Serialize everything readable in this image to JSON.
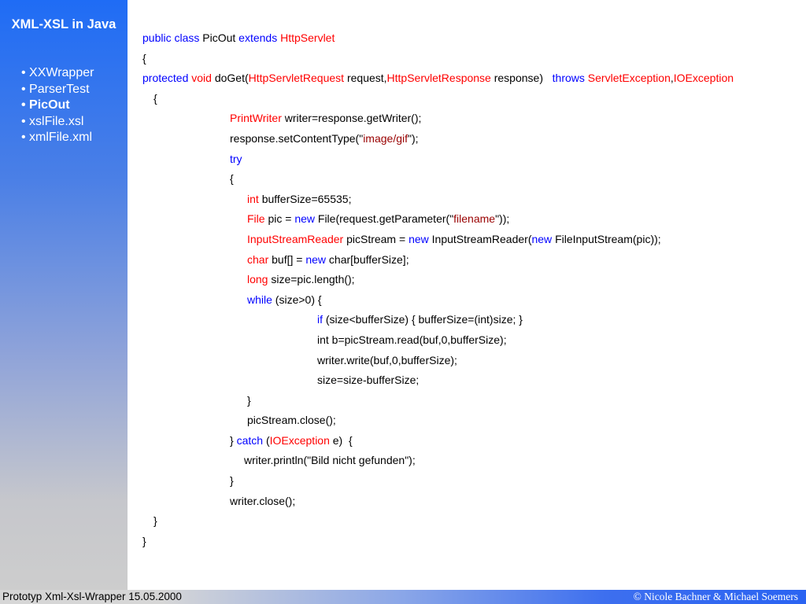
{
  "sidebar": {
    "title": "XML-XSL in Java",
    "items": [
      {
        "label": "• XXWrapper",
        "active": false
      },
      {
        "label": "• ParserTest",
        "active": false
      },
      {
        "label": "• PicOut",
        "active": true
      },
      {
        "label": "• xslFile.xsl",
        "active": false
      },
      {
        "label": "• xmlFile.xml",
        "active": false
      }
    ]
  },
  "colors": {
    "keyword": "#0000ff",
    "type": "#ff0000",
    "string": "#990000",
    "text": "#000000"
  },
  "code": [
    {
      "indent": 0,
      "tokens": [
        [
          "k",
          "public class "
        ],
        [
          "p",
          "PicOut "
        ],
        [
          "k",
          "extends "
        ],
        [
          "t",
          "HttpServlet"
        ]
      ]
    },
    {
      "indent": 0,
      "tokens": [
        [
          "p",
          "{"
        ]
      ]
    },
    {
      "indent": 0,
      "tokens": [
        [
          "k",
          "protected "
        ],
        [
          "t",
          "void "
        ],
        [
          "p",
          "doGet("
        ],
        [
          "t",
          "HttpServletRequest "
        ],
        [
          "p",
          "request,"
        ],
        [
          "t",
          "HttpServletResponse "
        ],
        [
          "p",
          "response)   "
        ],
        [
          "k",
          "throws "
        ],
        [
          "t",
          "ServletException"
        ],
        [
          "p",
          ","
        ],
        [
          "t",
          "IOException"
        ]
      ]
    },
    {
      "indent": 1,
      "tokens": [
        [
          "p",
          "{"
        ]
      ]
    },
    {
      "indent": 2,
      "tokens": [
        [
          "t",
          "PrintWriter "
        ],
        [
          "p",
          "writer=response.getWriter();"
        ]
      ]
    },
    {
      "indent": 2,
      "tokens": [
        [
          "p",
          "response.setContentType(\""
        ],
        [
          "s",
          "image/gif"
        ],
        [
          "p",
          "\");"
        ]
      ]
    },
    {
      "indent": 2,
      "tokens": [
        [
          "k",
          "try"
        ]
      ]
    },
    {
      "indent": 2,
      "tokens": [
        [
          "p",
          "{"
        ]
      ]
    },
    {
      "indent": 3,
      "tokens": [
        [
          "t",
          "int "
        ],
        [
          "p",
          "bufferSize=65535;"
        ]
      ]
    },
    {
      "indent": 3,
      "tokens": [
        [
          "t",
          "File "
        ],
        [
          "p",
          "pic = "
        ],
        [
          "k",
          "new "
        ],
        [
          "p",
          "File(request.getParameter(\""
        ],
        [
          "s",
          "filename"
        ],
        [
          "p",
          "\"));"
        ]
      ]
    },
    {
      "indent": 3,
      "tokens": [
        [
          "t",
          "InputStreamReader "
        ],
        [
          "p",
          "picStream = "
        ],
        [
          "k",
          "new "
        ],
        [
          "p",
          "InputStreamReader("
        ],
        [
          "k",
          "new "
        ],
        [
          "p",
          "FileInputStream(pic));"
        ]
      ]
    },
    {
      "indent": 3,
      "tokens": [
        [
          "t",
          "char "
        ],
        [
          "p",
          "buf[] = "
        ],
        [
          "k",
          "new "
        ],
        [
          "p",
          "char[bufferSize];"
        ]
      ]
    },
    {
      "indent": 3,
      "tokens": [
        [
          "t",
          "long "
        ],
        [
          "p",
          "size=pic.length();"
        ]
      ]
    },
    {
      "indent": 3,
      "tokens": [
        [
          "k",
          "while "
        ],
        [
          "p",
          "(size>0) {"
        ]
      ]
    },
    {
      "indent": 4,
      "tokens": [
        [
          "k",
          "if "
        ],
        [
          "p",
          "(size<bufferSize) { bufferSize=(int)size; }"
        ]
      ]
    },
    {
      "indent": 4,
      "tokens": [
        [
          "p",
          "int b=picStream.read(buf,0,bufferSize);"
        ]
      ]
    },
    {
      "indent": 4,
      "tokens": [
        [
          "p",
          "writer.write(buf,0,bufferSize);"
        ]
      ]
    },
    {
      "indent": 4,
      "tokens": [
        [
          "p",
          "size=size-bufferSize;"
        ]
      ]
    },
    {
      "indent": 3,
      "tokens": [
        [
          "p",
          "}"
        ]
      ]
    },
    {
      "indent": 3,
      "tokens": [
        [
          "p",
          "picStream.close();"
        ]
      ]
    },
    {
      "indent": 2,
      "tokens": [
        [
          "p",
          "} "
        ],
        [
          "k",
          "catch "
        ],
        [
          "p",
          "("
        ],
        [
          "t",
          "IOException "
        ],
        [
          "p",
          "e)  {"
        ]
      ]
    },
    {
      "indent": 5,
      "tokens": [
        [
          "p",
          "writer.println(\"Bild nicht gefunden\");"
        ]
      ]
    },
    {
      "indent": 2,
      "tokens": [
        [
          "p",
          "}"
        ]
      ]
    },
    {
      "indent": 2,
      "tokens": [
        [
          "p",
          "writer.close();"
        ]
      ]
    },
    {
      "indent": 1,
      "tokens": [
        [
          "p",
          "}"
        ]
      ]
    },
    {
      "indent": 0,
      "tokens": [
        [
          "p",
          "}"
        ]
      ]
    }
  ],
  "footer": {
    "left": "Prototyp Xml-Xsl-Wrapper 15.05.2000",
    "right": "© Nicole Bachner & Michael Soemers"
  }
}
